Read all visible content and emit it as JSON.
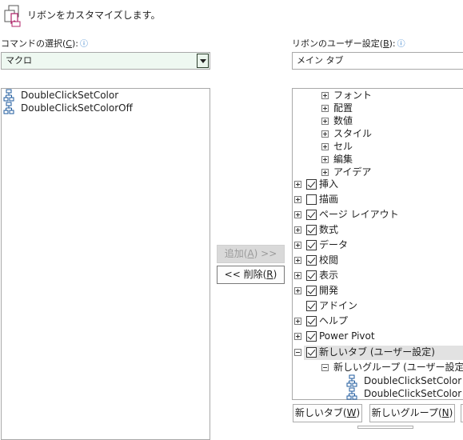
{
  "header": {
    "title": "リボンをカスタマイズします。"
  },
  "left": {
    "label_prefix": "コマンドの選択(",
    "label_key": "C",
    "label_suffix": "):",
    "info_icon": "info-icon",
    "dropdown_value": "マクロ",
    "commands": [
      "DoubleClickSetColor",
      "DoubleClickSetColorOff"
    ]
  },
  "right": {
    "label_prefix": "リボンのユーザー設定(",
    "label_key": "B",
    "label_suffix": "):",
    "dropdown_value": "メイン タブ",
    "tree": {
      "subgroups": [
        "フォント",
        "配置",
        "数値",
        "スタイル",
        "セル",
        "編集",
        "アイデア"
      ],
      "tabs": [
        {
          "label": "挿入",
          "checked": true,
          "expander": "plus"
        },
        {
          "label": "描画",
          "checked": false,
          "expander": "plus"
        },
        {
          "label": "ページ レイアウト",
          "checked": true,
          "expander": "plus"
        },
        {
          "label": "数式",
          "checked": true,
          "expander": "plus"
        },
        {
          "label": "データ",
          "checked": true,
          "expander": "plus"
        },
        {
          "label": "校閲",
          "checked": true,
          "expander": "plus"
        },
        {
          "label": "表示",
          "checked": true,
          "expander": "plus"
        },
        {
          "label": "開発",
          "checked": true,
          "expander": "plus"
        },
        {
          "label": "アドイン",
          "checked": true,
          "expander": "none"
        },
        {
          "label": "ヘルプ",
          "checked": true,
          "expander": "plus"
        },
        {
          "label": "Power Pivot",
          "checked": true,
          "expander": "plus"
        },
        {
          "label": "新しいタブ (ユーザー設定)",
          "checked": true,
          "expander": "minus"
        }
      ],
      "new_group": "新しいグループ (ユーザー設定)",
      "group_items": [
        "DoubleClickSetColor",
        "DoubleClickSetColor"
      ]
    }
  },
  "buttons": {
    "add": {
      "prefix": "追加(",
      "key": "A",
      "suffix": ") >>"
    },
    "remove": {
      "prefix": "<< 削除(",
      "key": "R",
      "suffix": ")"
    },
    "new_tab": {
      "prefix": "新しいタブ(",
      "key": "W",
      "suffix": ")"
    },
    "new_group": {
      "prefix": "新しいグループ(",
      "key": "N",
      "suffix": ")"
    }
  }
}
